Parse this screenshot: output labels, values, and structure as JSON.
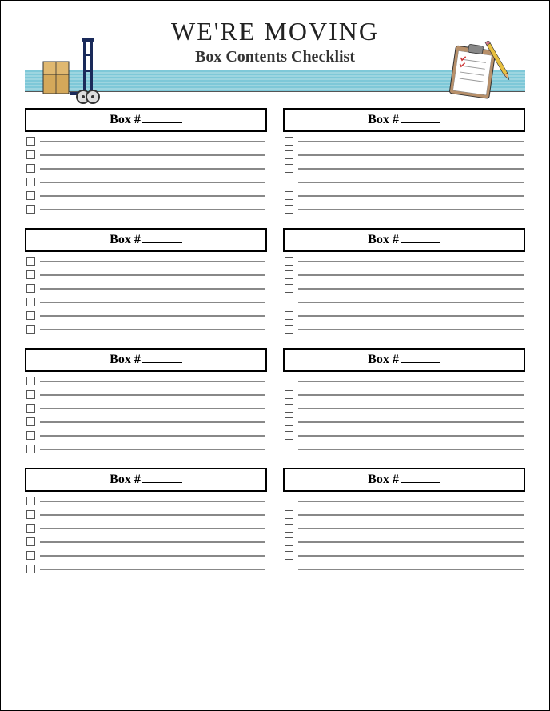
{
  "header": {
    "title": "We're Moving",
    "subtitle": "Box Contents Checklist"
  },
  "boxLabel": "Box #",
  "boxCount": 8,
  "itemsPerBox": 6
}
